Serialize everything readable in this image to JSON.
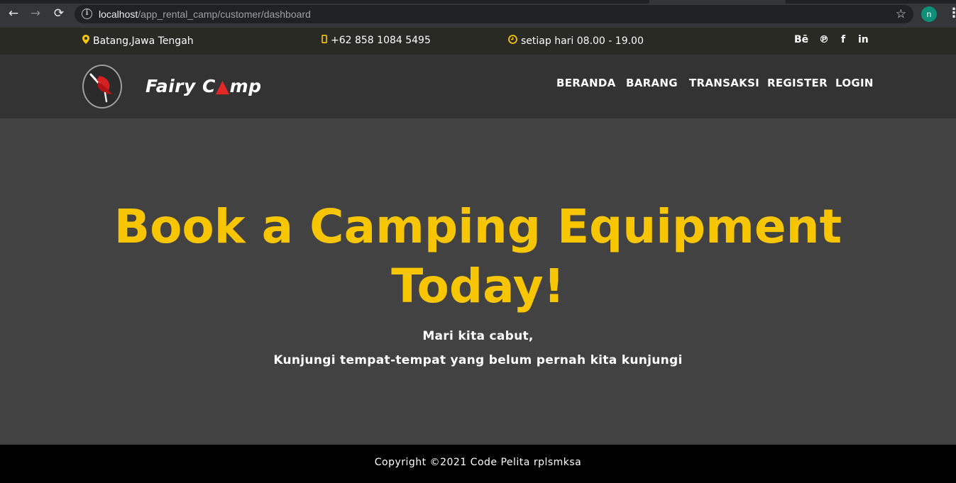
{
  "browser": {
    "url_host": "localhost",
    "url_path": "/app_rental_camp/customer/dashboard",
    "profile_initial": "n",
    "back_icon": "←",
    "forward_icon": "→",
    "reload_icon": "⟳",
    "info_icon": "i",
    "star_icon": "☆",
    "menu_icon": "⋮"
  },
  "topbar": {
    "location": "Batang,Jawa Tengah",
    "phone": "+62 858 1084 5495",
    "hours": "setiap hari 08.00 - 19.00",
    "social": [
      "Bē",
      "℗",
      "f",
      "in"
    ]
  },
  "header": {
    "brand_part1": "Fairy C",
    "brand_triangle": "▲",
    "brand_part2": "mp",
    "menu": [
      "BERANDA",
      "BARANG",
      "TRANSAKSI",
      "REGISTER",
      "LOGIN"
    ]
  },
  "hero": {
    "title_line1": "Book a Camping Equipment",
    "title_line2": "Today!",
    "subtitle_line1": "Mari kita cabut,",
    "subtitle_line2": "Kunjungi tempat-tempat yang belum pernah kita kunjungi"
  },
  "footer": {
    "copyright": "Copyright ©2021 Code Pelita rplsmksa"
  },
  "colors": {
    "accent": "#f7c600",
    "topbar_bg": "#292a23",
    "header_bg": "#333333",
    "hero_bg": "#424242",
    "footer_bg": "#000000"
  }
}
